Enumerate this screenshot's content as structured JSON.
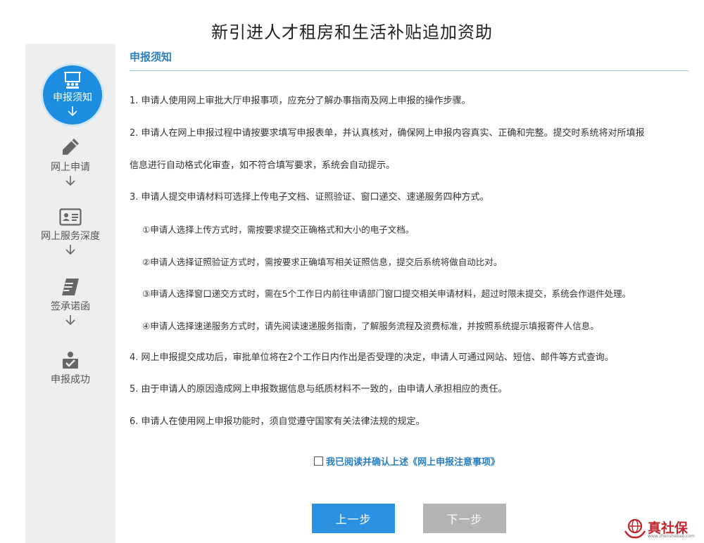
{
  "page": {
    "title": "新引进人才租房和生活补贴追加资助"
  },
  "sidebar": {
    "steps": [
      {
        "label": "申报须知",
        "icon": "presentation-icon",
        "active": true
      },
      {
        "label": "网上申请",
        "icon": "pencil-icon",
        "active": false
      },
      {
        "label": "网上服务深度",
        "icon": "id-card-icon",
        "active": false
      },
      {
        "label": "签承诺函",
        "icon": "document-icon",
        "active": false
      },
      {
        "label": "申报成功",
        "icon": "check-user-icon",
        "active": false
      }
    ]
  },
  "section": {
    "title": "申报须知"
  },
  "notice": {
    "items": [
      "1. 申请人使用网上审批大厅申报事项，应充分了解办事指南及网上申报的操作步骤。",
      "2. 申请人在网上申报过程中请按要求填写申报表单，并认真核对，确保网上申报内容真实、正确和完整。提交时系统将对所填报",
      "信息进行自动格式化审查，如不符合填写要求，系统会自动提示。",
      "3. 申请人提交申请材料可选择上传电子文档、证照验证、窗口递交、速递服务四种方式。",
      "①申请人选择上传方式时，需按要求提交正确格式和大小的电子文档。",
      "②申请人选择证照验证方式时，需按要求正确填写相关证照信息，提交后系统将做自动比对。",
      "③申请人选择窗口递交方式时，需在5个工作日内前往申请部门窗口提交相关申请材料，超过时限未提交，系统会作退件处理。",
      "④申请人选择速递服务方式时，请先阅读速递服务指南，了解服务流程及资费标准，并按照系统提示填报寄件人信息。",
      "4. 网上申报提交成功后，审批单位将在2个工作日内作出是否受理的决定，申请人可通过网站、短信、邮件等方式查询。",
      "5. 由于申请人的原因造成网上申报数据信息与纸质材料不一致的，由申请人承担相应的责任。",
      "6. 申请人在使用网上申报功能时，须自觉遵守国家有关法律法规的规定。"
    ]
  },
  "agreement": {
    "label": "我已阅读并确认上述《网上申报注意事项》",
    "checked": false
  },
  "buttons": {
    "prev": "上一步",
    "next": "下一步"
  },
  "watermark": {
    "text": "真社保",
    "sub": "www.zhenshebao.com"
  },
  "colors": {
    "accent": "#2b91e0",
    "active_step": "#1c8de0",
    "disabled": "#b3b3b3",
    "watermark": "#c0262d"
  }
}
